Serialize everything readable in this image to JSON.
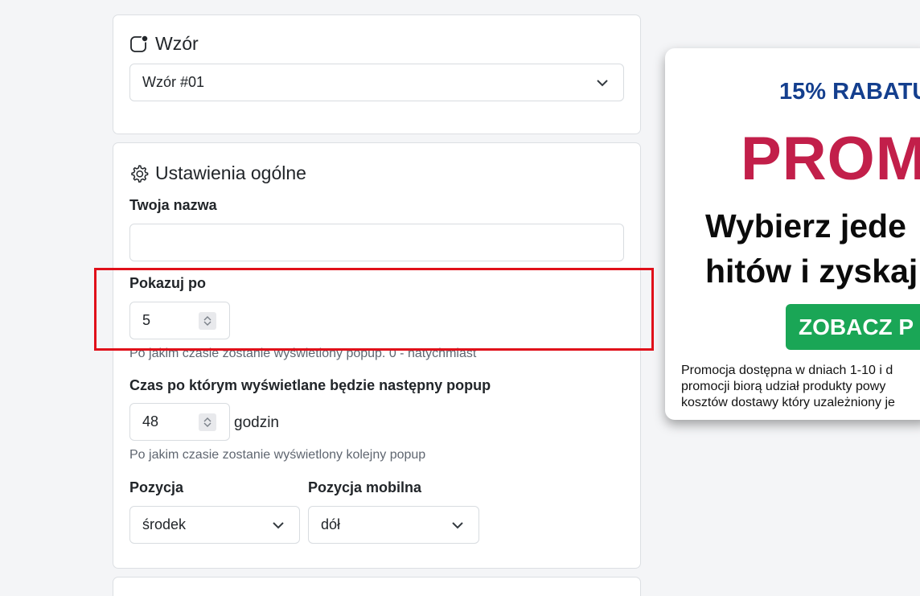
{
  "template_card": {
    "title": "Wzór",
    "icon": "app-badge-icon",
    "select_value": "Wzór #01"
  },
  "settings_card": {
    "title": "Ustawienia ogólne",
    "icon": "gear-icon",
    "name_label": "Twoja nazwa",
    "name_value": "",
    "show_after_label": "Pokazuj po",
    "show_after_value": "5",
    "show_after_help": "Po jakim czasie zostanie wyświetlony popup. 0 - natychmiast",
    "next_popup_label": "Czas po którym wyświetlane będzie następny popup",
    "next_popup_value": "48",
    "next_popup_suffix": "godzin",
    "next_popup_help": "Po jakim czasie zostanie wyświetlony kolejny popup",
    "position_label": "Pozycja",
    "position_value": "środek",
    "mobile_position_label": "Pozycja mobilna",
    "mobile_position_value": "dół"
  },
  "preview": {
    "discount": "15% RABATU",
    "headline": "PROM",
    "subheadline_line1": "Wybierz jede",
    "subheadline_line2": "hitów i zyskaj",
    "cta": "ZOBACZ P",
    "fine_print_line1": "Promocja dostępna w dniach 1-10 i d",
    "fine_print_line2": "promocji biorą udział produkty powy",
    "fine_print_line3": "kosztów dostawy który uzależniony je"
  },
  "colors": {
    "highlight": "#e0101a",
    "discount_text": "#143f8e",
    "headline_text": "#c21f4a",
    "cta_bg": "#1aa656"
  }
}
